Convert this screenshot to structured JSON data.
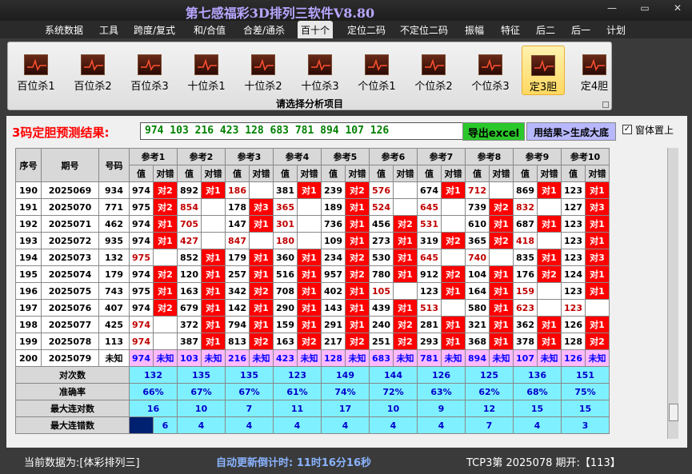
{
  "title": "第七感福彩3D排列三软件V8.80",
  "window_buttons": [
    "—",
    "▭",
    "✕"
  ],
  "menu": [
    "系统数据",
    "工具",
    "跨度/复式",
    "和/合值",
    "合差/通杀",
    "百十个",
    "定位二码",
    "不定位二码",
    "振幅",
    "特征",
    "后二",
    "后一",
    "计划"
  ],
  "menu_active": 5,
  "ribbon": {
    "buttons": [
      "百位杀1",
      "百位杀2",
      "百位杀3",
      "十位杀1",
      "十位杀2",
      "十位杀3",
      "个位杀1",
      "个位杀2",
      "个位杀3",
      "定3胆",
      "定4胆"
    ],
    "selected": 9,
    "caption": "请选择分析项目"
  },
  "prediction": {
    "label": "3码定胆预测结果:",
    "value": "974 103 216 423 128 683 781 894 107 126",
    "excel_button": "导出excel",
    "generate_button": "用结果>生成大底",
    "topmost_label": "窗体置上",
    "topmost_checked": true
  },
  "table": {
    "headers": [
      "序号",
      "期号",
      "号码"
    ],
    "ref_headers": [
      "参考1",
      "参考2",
      "参考3",
      "参考4",
      "参考5",
      "参考6",
      "参考7",
      "参考8",
      "参考9",
      "参考10"
    ],
    "sub_value": "值",
    "sub_result": "对错",
    "rows": [
      {
        "seq": "190",
        "issue": "2025069",
        "num": "934",
        "refs": [
          [
            "974",
            "对2"
          ],
          [
            "892",
            "对1"
          ],
          [
            "186",
            ""
          ],
          [
            "381",
            "对1"
          ],
          [
            "239",
            "对2"
          ],
          [
            "576",
            ""
          ],
          [
            "674",
            "对1"
          ],
          [
            "712",
            ""
          ],
          [
            "869",
            "对1"
          ],
          [
            "123",
            "对1"
          ]
        ]
      },
      {
        "seq": "191",
        "issue": "2025070",
        "num": "771",
        "refs": [
          [
            "975",
            "对2"
          ],
          [
            "854",
            ""
          ],
          [
            "178",
            "对3"
          ],
          [
            "365",
            ""
          ],
          [
            "189",
            "对1"
          ],
          [
            "524",
            ""
          ],
          [
            "645",
            ""
          ],
          [
            "739",
            "对2"
          ],
          [
            "832",
            ""
          ],
          [
            "127",
            "对3"
          ]
        ]
      },
      {
        "seq": "192",
        "issue": "2025071",
        "num": "462",
        "refs": [
          [
            "974",
            "对1"
          ],
          [
            "705",
            ""
          ],
          [
            "147",
            "对1"
          ],
          [
            "301",
            ""
          ],
          [
            "736",
            "对1"
          ],
          [
            "456",
            "对2"
          ],
          [
            "531",
            ""
          ],
          [
            "610",
            "对1"
          ],
          [
            "687",
            "对1"
          ],
          [
            "123",
            "对1"
          ]
        ]
      },
      {
        "seq": "193",
        "issue": "2025072",
        "num": "935",
        "refs": [
          [
            "974",
            "对1"
          ],
          [
            "427",
            ""
          ],
          [
            "847",
            ""
          ],
          [
            "180",
            ""
          ],
          [
            "109",
            "对1"
          ],
          [
            "273",
            "对1"
          ],
          [
            "319",
            "对2"
          ],
          [
            "365",
            "对2"
          ],
          [
            "418",
            ""
          ],
          [
            "123",
            "对1"
          ]
        ]
      },
      {
        "seq": "194",
        "issue": "2025073",
        "num": "132",
        "refs": [
          [
            "975",
            ""
          ],
          [
            "852",
            "对1"
          ],
          [
            "179",
            "对1"
          ],
          [
            "360",
            "对1"
          ],
          [
            "234",
            "对2"
          ],
          [
            "530",
            "对1"
          ],
          [
            "645",
            ""
          ],
          [
            "740",
            ""
          ],
          [
            "835",
            "对1"
          ],
          [
            "123",
            "对3"
          ]
        ]
      },
      {
        "seq": "195",
        "issue": "2025074",
        "num": "179",
        "refs": [
          [
            "974",
            "对2"
          ],
          [
            "120",
            "对1"
          ],
          [
            "257",
            "对1"
          ],
          [
            "516",
            "对1"
          ],
          [
            "957",
            "对2"
          ],
          [
            "780",
            "对1"
          ],
          [
            "912",
            "对2"
          ],
          [
            "104",
            "对1"
          ],
          [
            "176",
            "对2"
          ],
          [
            "124",
            "对1"
          ]
        ]
      },
      {
        "seq": "196",
        "issue": "2025075",
        "num": "743",
        "refs": [
          [
            "975",
            "对1"
          ],
          [
            "163",
            "对1"
          ],
          [
            "342",
            "对2"
          ],
          [
            "708",
            "对1"
          ],
          [
            "402",
            "对1"
          ],
          [
            "105",
            ""
          ],
          [
            "123",
            "对1"
          ],
          [
            "164",
            "对1"
          ],
          [
            "159",
            ""
          ],
          [
            "123",
            "对1"
          ]
        ]
      },
      {
        "seq": "197",
        "issue": "2025076",
        "num": "407",
        "refs": [
          [
            "974",
            "对2"
          ],
          [
            "679",
            "对1"
          ],
          [
            "142",
            "对1"
          ],
          [
            "290",
            "对1"
          ],
          [
            "143",
            "对1"
          ],
          [
            "439",
            "对1"
          ],
          [
            "513",
            ""
          ],
          [
            "580",
            "对1"
          ],
          [
            "623",
            ""
          ],
          [
            "123",
            ""
          ]
        ]
      },
      {
        "seq": "198",
        "issue": "2025077",
        "num": "425",
        "refs": [
          [
            "974",
            ""
          ],
          [
            "372",
            "对1"
          ],
          [
            "794",
            "对1"
          ],
          [
            "159",
            "对1"
          ],
          [
            "291",
            "对1"
          ],
          [
            "240",
            "对2"
          ],
          [
            "281",
            "对1"
          ],
          [
            "321",
            "对1"
          ],
          [
            "362",
            "对1"
          ],
          [
            "126",
            "对1"
          ]
        ]
      },
      {
        "seq": "199",
        "issue": "2025078",
        "num": "113",
        "refs": [
          [
            "974",
            ""
          ],
          [
            "387",
            "对1"
          ],
          [
            "813",
            "对2"
          ],
          [
            "163",
            "对2"
          ],
          [
            "217",
            "对2"
          ],
          [
            "251",
            "对2"
          ],
          [
            "293",
            "对1"
          ],
          [
            "368",
            "对1"
          ],
          [
            "378",
            "对1"
          ],
          [
            "128",
            "对2"
          ]
        ]
      }
    ],
    "last_row": {
      "seq": "200",
      "issue": "2025079",
      "num": "未知",
      "refs": [
        [
          "974",
          "未知"
        ],
        [
          "103",
          "未知"
        ],
        [
          "216",
          "未知"
        ],
        [
          "423",
          "未知"
        ],
        [
          "128",
          "未知"
        ],
        [
          "683",
          "未知"
        ],
        [
          "781",
          "未知"
        ],
        [
          "894",
          "未知"
        ],
        [
          "107",
          "未知"
        ],
        [
          "126",
          "未知"
        ]
      ]
    },
    "stats": [
      {
        "label": "对次数",
        "values": [
          "132",
          "135",
          "135",
          "123",
          "149",
          "144",
          "126",
          "125",
          "136",
          "151"
        ]
      },
      {
        "label": "准确率",
        "values": [
          "66%",
          "67%",
          "67%",
          "61%",
          "74%",
          "72%",
          "63%",
          "62%",
          "68%",
          "75%"
        ]
      },
      {
        "label": "最大连对数",
        "values": [
          "16",
          "10",
          "7",
          "11",
          "17",
          "10",
          "9",
          "12",
          "15",
          "15"
        ]
      },
      {
        "label": "最大连错数",
        "values": [
          "6",
          "4",
          "4",
          "4",
          "4",
          "4",
          "4",
          "7",
          "4",
          "3"
        ]
      }
    ]
  },
  "status": {
    "current_data": "当前数据为:[体彩排列三]",
    "countdown": "自动更新倒计时: 11时16分16秒",
    "draw": "TCP3第 2025078 期开:【113】"
  },
  "colors": {
    "hit": "#ff0000",
    "stat": "#7ff0ff",
    "last_row": "#ffbaff",
    "title": "#b8a6ff"
  }
}
